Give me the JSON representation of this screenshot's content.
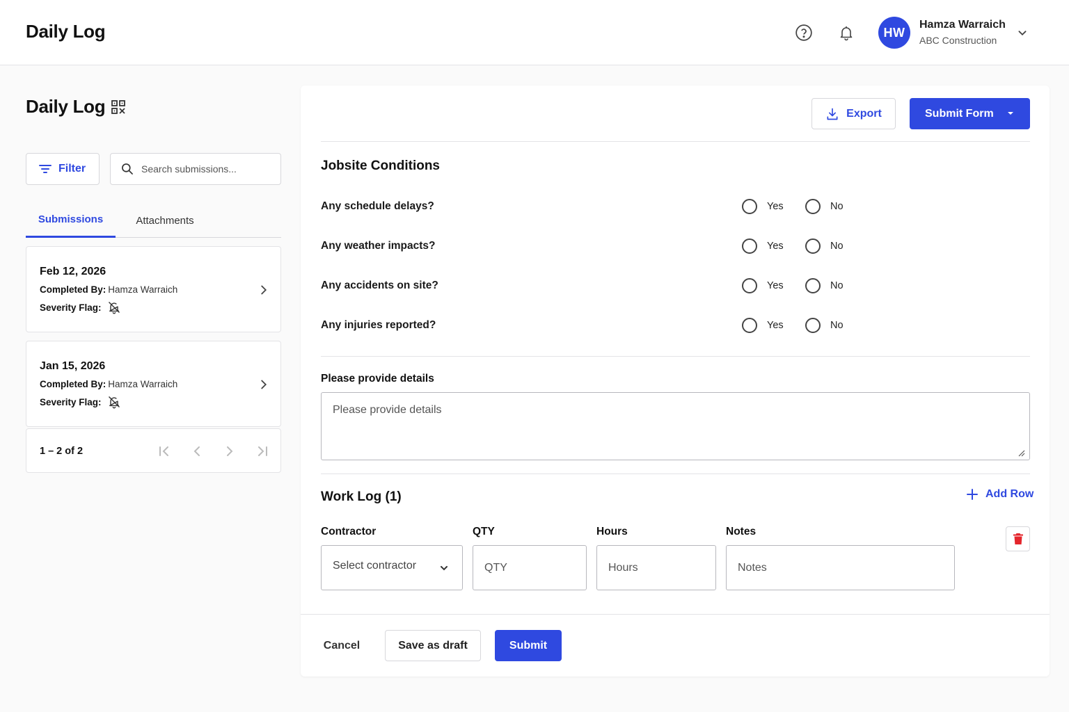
{
  "header": {
    "app_title": "Daily Log",
    "help_icon": "help-circle-icon",
    "notification_icon": "bell-icon",
    "user": {
      "initials": "HW",
      "name": "Hamza Warraich",
      "org": "ABC Construction"
    }
  },
  "sidebar": {
    "title": "Daily Log",
    "filter_label": "Filter",
    "search_placeholder": "Search submissions...",
    "tabs": [
      {
        "label": "Submissions",
        "active": true
      },
      {
        "label": "Attachments",
        "active": false
      }
    ],
    "submissions": [
      {
        "date": "Feb 12, 2026",
        "completed_by_label": "Completed By:",
        "completed_by": "Hamza Warraich",
        "severity_label": "Severity Flag:",
        "severity_icon": "bell-off-icon"
      },
      {
        "date": "Jan 15, 2026",
        "completed_by_label": "Completed By:",
        "completed_by": "Hamza Warraich",
        "severity_label": "Severity Flag:",
        "severity_icon": "bell-off-icon"
      }
    ],
    "pagination": "1 – 2 of 2"
  },
  "form": {
    "export_label": "Export",
    "submit_form_label": "Submit Form",
    "jobsite_title": "Jobsite Conditions",
    "questions": [
      {
        "label": "Any schedule delays?",
        "yes": "Yes",
        "no": "No"
      },
      {
        "label": "Any weather impacts?",
        "yes": "Yes",
        "no": "No"
      },
      {
        "label": "Any accidents on site?",
        "yes": "Yes",
        "no": "No"
      },
      {
        "label": "Any injuries reported?",
        "yes": "Yes",
        "no": "No"
      }
    ],
    "details_label": "Please provide details",
    "details_placeholder": "Please provide details",
    "worklog_title": "Work Log (1)",
    "add_row_label": "Add Row",
    "columns": {
      "contractor": "Contractor",
      "qty": "QTY",
      "hours": "Hours",
      "notes": "Notes"
    },
    "row": {
      "contractor_placeholder": "Select contractor",
      "qty_placeholder": "QTY",
      "hours_placeholder": "Hours",
      "notes_placeholder": "Notes"
    },
    "footer": {
      "cancel": "Cancel",
      "save_draft": "Save as draft",
      "submit": "Submit"
    }
  },
  "colors": {
    "primary": "#2f49e0",
    "danger": "#e4262c",
    "border": "#d7d7db"
  }
}
